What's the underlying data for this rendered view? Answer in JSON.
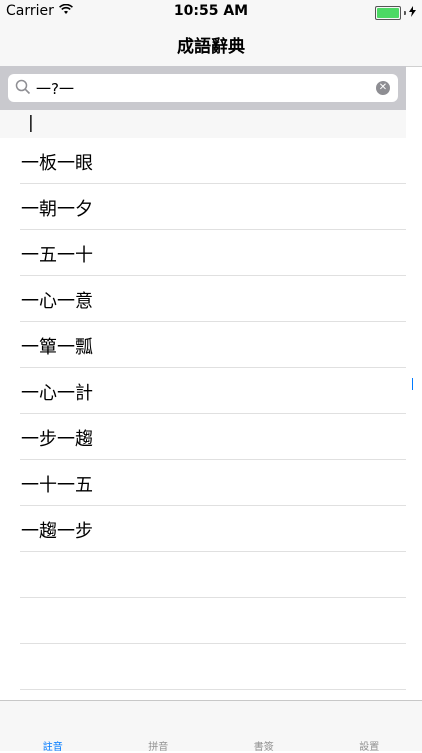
{
  "status_bar": {
    "carrier": "Carrier",
    "time": "10:55 AM",
    "battery_level": 1.0
  },
  "nav": {
    "title": "成語辭典"
  },
  "search": {
    "value": "一?一"
  },
  "section": {
    "label": "|"
  },
  "list": {
    "items": [
      {
        "label": "一板一眼"
      },
      {
        "label": "一朝一夕"
      },
      {
        "label": "一五一十"
      },
      {
        "label": "一心一意"
      },
      {
        "label": "一簞一瓢"
      },
      {
        "label": "一心一計"
      },
      {
        "label": "一步一趨"
      },
      {
        "label": "一十一五"
      },
      {
        "label": "一趨一步"
      }
    ]
  },
  "tabs": [
    {
      "label": "註音",
      "active": true
    },
    {
      "label": "拼音",
      "active": false
    },
    {
      "label": "書簽",
      "active": false
    },
    {
      "label": "設置",
      "active": false
    }
  ],
  "colors": {
    "accent": "#007aff",
    "battery": "#4cd964"
  }
}
